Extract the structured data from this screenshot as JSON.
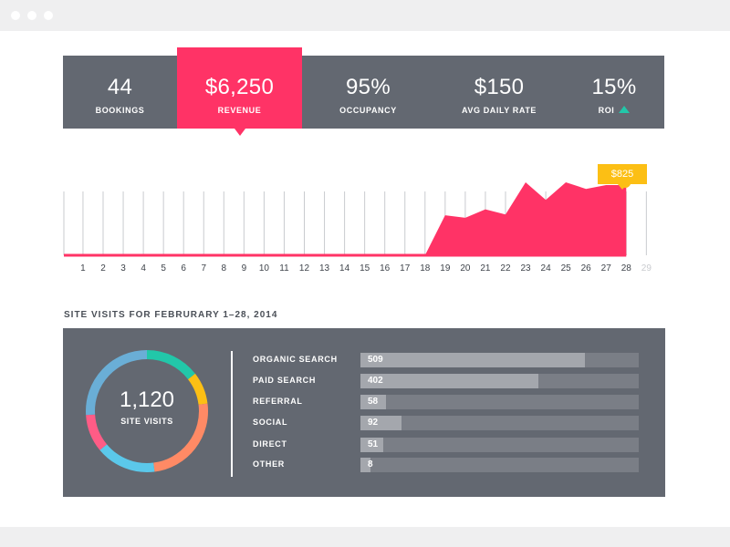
{
  "window": {
    "controls": [
      "dot",
      "dot",
      "dot"
    ]
  },
  "kpis": [
    {
      "value": "44",
      "label": "BOOKINGS",
      "active": false
    },
    {
      "value": "$6,250",
      "label": "REVENUE",
      "active": true
    },
    {
      "value": "95%",
      "label": "OCCUPANCY",
      "active": false
    },
    {
      "value": "$150",
      "label": "AVG DAILY RATE",
      "active": false
    },
    {
      "value": "15%",
      "label": "ROI",
      "active": false,
      "trend": "up"
    }
  ],
  "colors": {
    "panel": "#636871",
    "accent": "#ff3366",
    "highlight": "#fcbf14",
    "trend_up": "#22c7a9"
  },
  "chart_data": {
    "type": "area",
    "x": [
      1,
      2,
      3,
      4,
      5,
      6,
      7,
      8,
      9,
      10,
      11,
      12,
      13,
      14,
      15,
      16,
      17,
      18,
      19,
      20,
      21,
      22,
      23,
      24,
      25,
      26,
      27,
      28
    ],
    "categories": [
      "1",
      "2",
      "3",
      "4",
      "5",
      "6",
      "7",
      "8",
      "9",
      "10",
      "11",
      "12",
      "13",
      "14",
      "15",
      "16",
      "17",
      "18",
      "19",
      "20",
      "21",
      "22",
      "23",
      "24",
      "25",
      "26",
      "27",
      "28",
      "29"
    ],
    "values": [
      0,
      0,
      0,
      0,
      0,
      0,
      0,
      0,
      0,
      0,
      0,
      0,
      0,
      0,
      0,
      0,
      0,
      0,
      470,
      440,
      540,
      480,
      900,
      650,
      980,
      780,
      825,
      825
    ],
    "ylim": [
      0,
      1200
    ],
    "highlight": {
      "day": 28,
      "label": "$825"
    },
    "grid": true,
    "inactive_categories": [
      "29"
    ]
  },
  "site_visits": {
    "title": "SITE VISITS FOR FEBRURARY 1–28, 2014",
    "total": "1,120",
    "total_label": "SITE VISITS",
    "max": 630,
    "sources": [
      {
        "name": "ORGANIC SEARCH",
        "value": 509,
        "color": "#22c7a9"
      },
      {
        "name": "PAID SEARCH",
        "value": 402,
        "color": "#fcbf14"
      },
      {
        "name": "REFERRAL",
        "value": 58,
        "color": "#ff8a65"
      },
      {
        "name": "SOCIAL",
        "value": 92,
        "color": "#5bc8ea"
      },
      {
        "name": "DIRECT",
        "value": 51,
        "color": "#ff5c86"
      },
      {
        "name": "OTHER",
        "value": 8,
        "color": "#6aaed6"
      }
    ],
    "donut_segments": [
      {
        "label": "segment-1",
        "fraction": 0.145,
        "color": "#22c7a9"
      },
      {
        "label": "segment-2",
        "fraction": 0.085,
        "color": "#fcbf14"
      },
      {
        "label": "segment-3",
        "fraction": 0.25,
        "color": "#ff8a65"
      },
      {
        "label": "segment-4",
        "fraction": 0.16,
        "color": "#5bc8ea"
      },
      {
        "label": "segment-5",
        "fraction": 0.1,
        "color": "#ff5c86"
      },
      {
        "label": "segment-6",
        "fraction": 0.26,
        "color": "#6aaed6"
      }
    ]
  }
}
